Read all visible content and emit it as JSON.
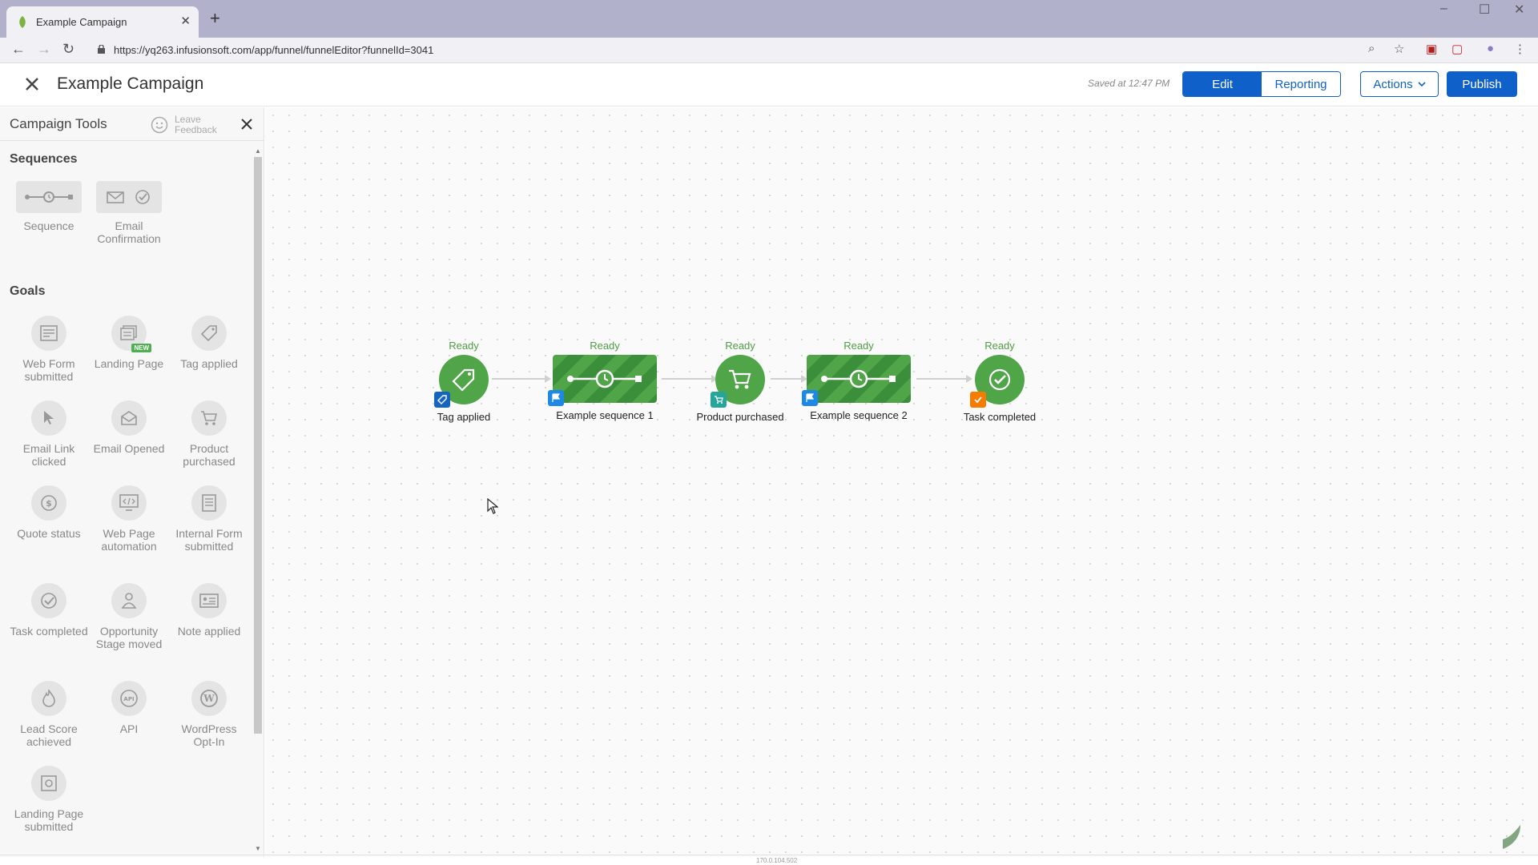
{
  "browser": {
    "tab_title": "Example Campaign",
    "url": "https://yq263.infusionsoft.com/app/funnel/funnelEditor?funnelId=3041"
  },
  "header": {
    "title": "Example Campaign",
    "saved": "Saved at 12:47 PM",
    "edit": "Edit",
    "reporting": "Reporting",
    "actions": "Actions",
    "publish": "Publish"
  },
  "sidebar": {
    "title": "Campaign Tools",
    "feedback": "Leave Feedback",
    "sequences_heading": "Sequences",
    "sequences": [
      {
        "label": "Sequence",
        "icon": "sequence-icon"
      },
      {
        "label": "Email Confirmation",
        "icon": "email-check-icon"
      }
    ],
    "goals_heading": "Goals",
    "goals": [
      {
        "label": "Web Form submitted",
        "icon": "web-form-icon"
      },
      {
        "label": "Landing Page",
        "icon": "landing-page-icon",
        "badge": "NEW"
      },
      {
        "label": "Tag applied",
        "icon": "tag-icon"
      },
      {
        "label": "Email Link clicked",
        "icon": "cursor-icon"
      },
      {
        "label": "Email Opened",
        "icon": "envelope-icon"
      },
      {
        "label": "Product purchased",
        "icon": "cart-icon"
      },
      {
        "label": "Quote status",
        "icon": "dollar-icon"
      },
      {
        "label": "Web Page automation",
        "icon": "code-monitor-icon"
      },
      {
        "label": "Internal Form submitted",
        "icon": "document-icon"
      },
      {
        "label": "Task completed",
        "icon": "check-icon"
      },
      {
        "label": "Opportunity Stage moved",
        "icon": "person-icon"
      },
      {
        "label": "Note applied",
        "icon": "note-icon"
      },
      {
        "label": "Lead Score achieved",
        "icon": "flame-icon"
      },
      {
        "label": "API",
        "icon": "api-icon"
      },
      {
        "label": "WordPress Opt-In",
        "icon": "wordpress-icon"
      },
      {
        "label": "Landing Page submitted",
        "icon": "landing-submit-icon"
      }
    ]
  },
  "canvas": {
    "nodes": [
      {
        "status": "Ready",
        "label": "Tag applied",
        "kind": "goal",
        "icon": "tag-icon",
        "badge_color": "#1565c0"
      },
      {
        "status": "Ready",
        "label": "Example sequence 1",
        "kind": "sequence",
        "icon": "timer-sequence-icon",
        "badge_color": "#1e88e5"
      },
      {
        "status": "Ready",
        "label": "Product purchased",
        "kind": "goal",
        "icon": "cart-icon",
        "badge_color": "#26a69a"
      },
      {
        "status": "Ready",
        "label": "Example sequence 2",
        "kind": "sequence",
        "icon": "timer-sequence-icon",
        "badge_color": "#1e88e5"
      },
      {
        "status": "Ready",
        "label": "Task completed",
        "kind": "goal",
        "icon": "check-icon",
        "badge_color": "#f57c00"
      }
    ]
  },
  "footer": {
    "id_text": "170.0.104.502"
  },
  "colors": {
    "primary": "#1060c9",
    "node_green": "#4fa548",
    "status_green": "#4f9b43"
  }
}
